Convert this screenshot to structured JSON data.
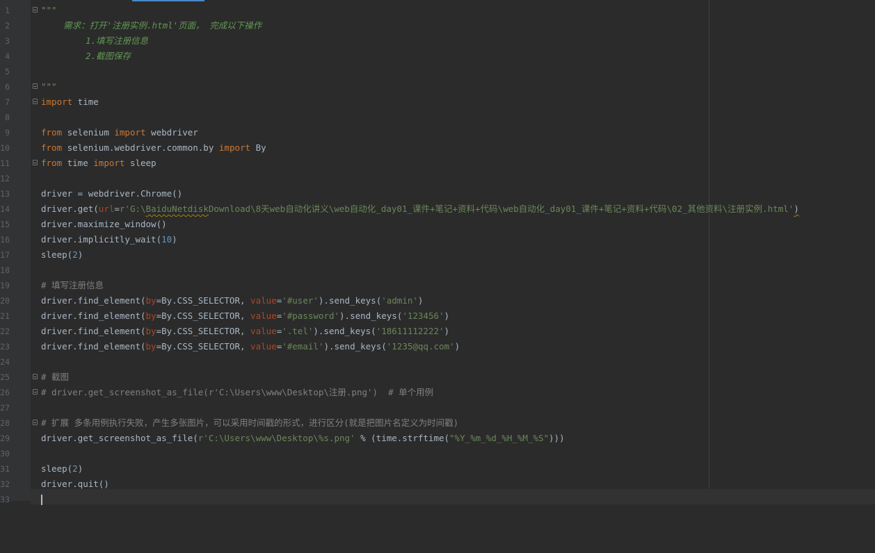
{
  "editor": {
    "line_numbers": [
      "1",
      "2",
      "3",
      "4",
      "5",
      "6",
      "7",
      "8",
      "9",
      "10",
      "11",
      "12",
      "13",
      "14",
      "15",
      "16",
      "17",
      "18",
      "19",
      "20",
      "21",
      "22",
      "23",
      "24",
      "25",
      "26",
      "27",
      "28",
      "29",
      "30",
      "31",
      "32",
      "33"
    ]
  },
  "code": {
    "l1": "\"\"\"",
    "l2": "需求：打开'注册实例.html'页面， 完成以下操作",
    "l3": "1.填写注册信息",
    "l4": "2.截图保存",
    "l6": "\"\"\"",
    "kw_import": "import",
    "kw_from": "from",
    "l7_mod": " time",
    "l9_mod": " selenium ",
    "l9_name": " webdriver",
    "l10_mod": " selenium.webdriver.common.by ",
    "l10_name": " By",
    "l11_mod": " time ",
    "l11_name": " sleep",
    "l13": "driver = webdriver.Chrome()",
    "l14_pre": "driver.get(",
    "l14_param": "url",
    "l14_eq": "=",
    "l14_str_a": "r'G:\\",
    "l14_str_squig": "BaiduNetdisk",
    "l14_str_b": "Download\\8天web自动化讲义\\web自动化_day01_课件+笔记+资料+代码\\web自动化_day01_课件+笔记+资料+代码\\02_其他资料\\注册实例.html'",
    "l14_close": ")",
    "l15": "driver.maximize_window()",
    "l16_pre": "driver.implicitly_wait(",
    "l16_num": "10",
    "l16_close": ")",
    "l17_pre": "sleep(",
    "l17_num": "2",
    "l17_close": ")",
    "l19": "# 填写注册信息",
    "fe_pre": "driver.find_element(",
    "p_by": "by",
    "fe_by_val": "=By.CSS_SELECTOR, ",
    "p_value": "value",
    "eq": "=",
    "send_keys": ").send_keys(",
    "close": ")",
    "l20_sel": "'#user'",
    "l20_key": "'admin'",
    "l21_sel": "'#password'",
    "l21_key": "'123456'",
    "l22_sel": "'.tel'",
    "l22_key": "'18611112222'",
    "l23_sel": "'#email'",
    "l23_key": "'1235@qq.com'",
    "l25": "# 截图",
    "l26": "# driver.get_screenshot_as_file(r'C:\\Users\\www\\Desktop\\注册.png')  # 单个用例",
    "l28": "# 扩展 多条用例执行失败，产生多张图片，可以采用时间戳的形式，进行区分(就是把图片名定义为时间戳)",
    "l29_pre": "driver.get_screenshot_as_file(",
    "l29_str": "r'C:\\Users\\www\\Desktop\\%s.png'",
    "l29_mid": " % (time.strftime(",
    "l29_fmt": "\"%Y_%m_%d_%H_%M_%S\"",
    "l29_close": ")))",
    "l31_pre": "sleep(",
    "l31_num": "2",
    "l31_close": ")",
    "l32": "driver.quit()"
  }
}
